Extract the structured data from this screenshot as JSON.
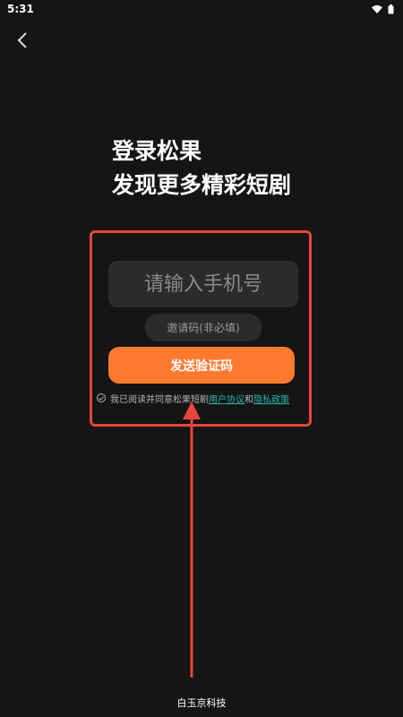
{
  "status_bar": {
    "time": "5:31"
  },
  "headline": {
    "line1": "登录松果",
    "line2": "发现更多精彩短剧"
  },
  "phone_input": {
    "placeholder": "请输入手机号",
    "value": ""
  },
  "invite_input": {
    "placeholder": "邀请码(非必填)",
    "value": ""
  },
  "send_button": {
    "label": "发送验证码"
  },
  "agreement": {
    "prefix": "我已阅读并同意松果短剧",
    "user_agreement": "用户协议",
    "connector": "和",
    "privacy_policy": "隐私政策"
  },
  "footer": {
    "company": "白玉京科技"
  },
  "colors": {
    "background": "#151515",
    "accent": "#ff7a2f",
    "link": "#27b7a7",
    "annotation": "#e8453c",
    "input_bg": "#2b2b2b"
  },
  "icons": [
    "wifi-icon",
    "battery-icon",
    "back-arrow-icon",
    "check-circle-icon"
  ]
}
